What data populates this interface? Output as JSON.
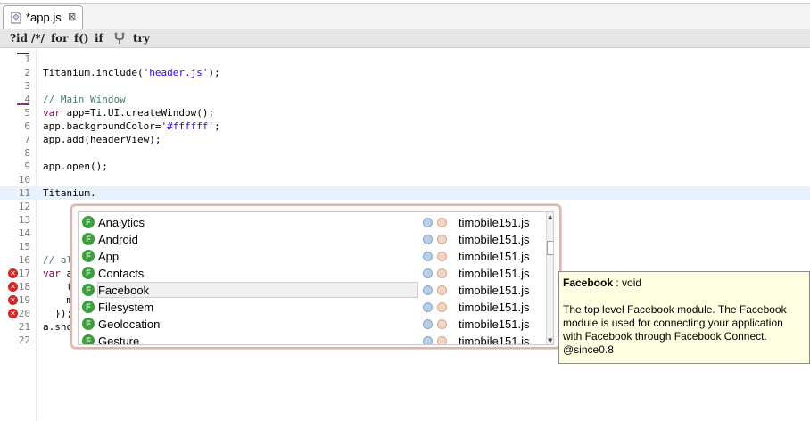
{
  "tab": {
    "title": "*app.js",
    "file_icon": "js-file-icon",
    "close_icon": "close-icon"
  },
  "toolbar": {
    "buttons": [
      {
        "label": "?id",
        "name": "insert-id-button"
      },
      {
        "label": "/*/",
        "name": "toggle-comment-button"
      },
      {
        "label": "for",
        "name": "insert-for-button"
      },
      {
        "label": "f()",
        "name": "insert-function-button"
      },
      {
        "label": "if",
        "name": "insert-if-button"
      },
      {
        "label": "",
        "name": "fork-icon"
      },
      {
        "label": "try",
        "name": "insert-try-button"
      }
    ]
  },
  "editor": {
    "current_line": 11,
    "lines": [
      {
        "n": "1",
        "text": ""
      },
      {
        "n": "2",
        "text": "Titanium.include('header.js');"
      },
      {
        "n": "3",
        "text": ""
      },
      {
        "n": "4",
        "text": "// Main Window"
      },
      {
        "n": "5",
        "text": "var app=Ti.UI.createWindow();"
      },
      {
        "n": "6",
        "text": "app.backgroundColor='#ffffff';"
      },
      {
        "n": "7",
        "text": "app.add(headerView);"
      },
      {
        "n": "8",
        "text": ""
      },
      {
        "n": "9",
        "text": "app.open();"
      },
      {
        "n": "10",
        "text": ""
      },
      {
        "n": "11",
        "text": "Titanium."
      },
      {
        "n": "12",
        "text": ""
      },
      {
        "n": "13",
        "text": ""
      },
      {
        "n": "14",
        "text": ""
      },
      {
        "n": "15",
        "text": ""
      },
      {
        "n": "16",
        "text": "// al"
      },
      {
        "n": "17",
        "text": "var a"
      },
      {
        "n": "18",
        "text": "    t"
      },
      {
        "n": "19",
        "text": "    m"
      },
      {
        "n": "20",
        "text": "  });"
      },
      {
        "n": "21",
        "text": "a.sho"
      },
      {
        "n": "22",
        "text": ""
      }
    ],
    "error_lines": [
      "17",
      "18",
      "19",
      "20"
    ],
    "colors": {
      "keyword": "#7f0055",
      "string": "#2a00ff",
      "comment": "#3f7f5f",
      "current_line_bg": "#e8f2fe"
    }
  },
  "autocomplete": {
    "selected_index": 4,
    "items": [
      {
        "name": "Analytics",
        "file": "timobile151.js"
      },
      {
        "name": "Android",
        "file": "timobile151.js"
      },
      {
        "name": "App",
        "file": "timobile151.js"
      },
      {
        "name": "Contacts",
        "file": "timobile151.js"
      },
      {
        "name": "Facebook",
        "file": "timobile151.js"
      },
      {
        "name": "Filesystem",
        "file": "timobile151.js"
      },
      {
        "name": "Geolocation",
        "file": "timobile151.js"
      },
      {
        "name": "Gesture",
        "file": "timobile151.js"
      }
    ],
    "item_icon_letter": "F",
    "item_icon_color": "#3aa13a"
  },
  "doc": {
    "name": "Facebook",
    "signature": " : void",
    "body_lines": [
      "The top level Facebook module. The Facebook",
      "module is used for connecting your application",
      "with Facebook through Facebook Connect.",
      "@since0.8"
    ]
  }
}
